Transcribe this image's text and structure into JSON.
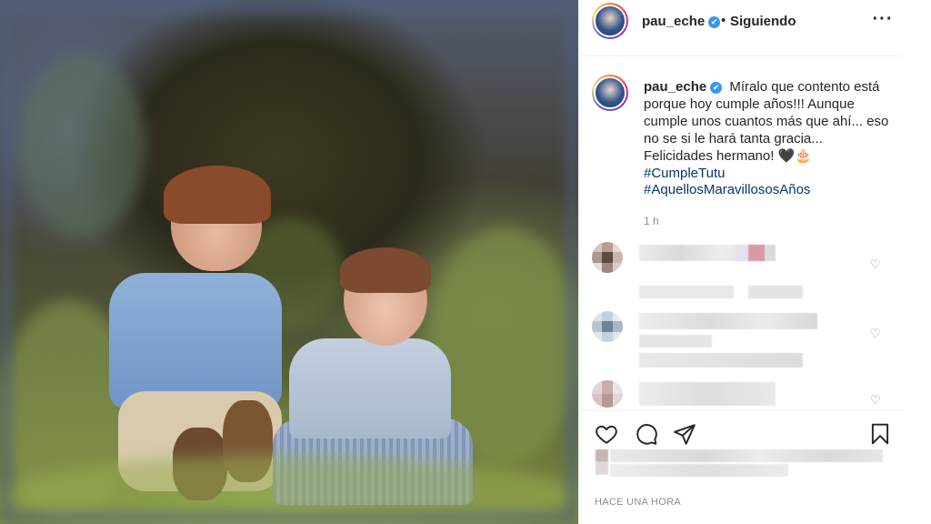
{
  "post": {
    "username": "pau_eche",
    "verified_mark": "✔",
    "separator": "•",
    "follow_status": "Siguiendo",
    "more_icon": "more-horizontal-icon",
    "caption": {
      "text": "Míralo que contento está porque hoy cumple años!!! Aunque cumple unos cuantos más que ahí... eso no se si le hará tanta gracia... Felicidades hermano! 🖤🎂",
      "hashtags": [
        "#CumpleTutu",
        "#AquellosMaravillososAños"
      ]
    },
    "age": "1 h",
    "timestamp": "HACE UNA HORA"
  },
  "actions": [
    "heart-icon",
    "comment-icon",
    "share-icon",
    "save-icon"
  ],
  "colors": {
    "link": "#00376b",
    "muted": "#8e8e8e",
    "verified": "#3897f0"
  }
}
